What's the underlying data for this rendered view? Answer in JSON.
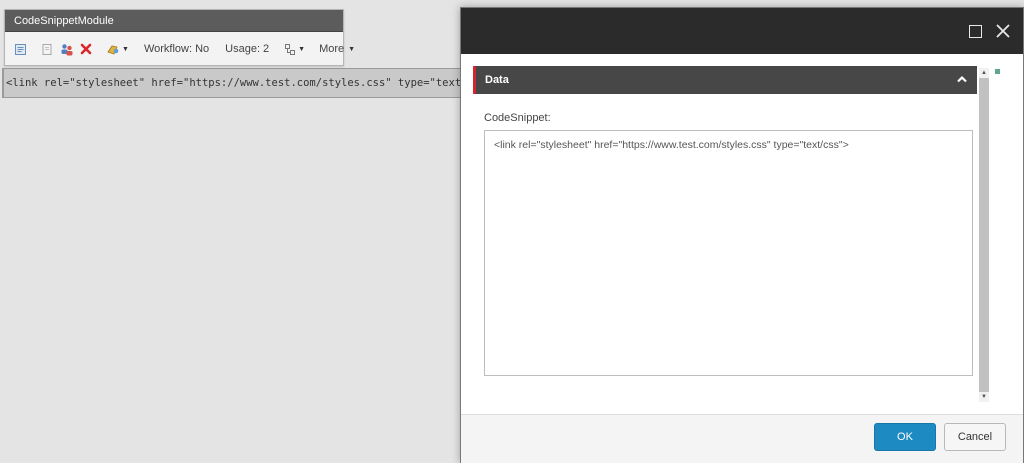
{
  "rendering": {
    "code": "<link rel=\"stylesheet\" href=\"https://www.test.com/styles.css\" type=\"text/css\">"
  },
  "chrome": {
    "title": "CodeSnippetModule",
    "workflow_label": "Workflow: No",
    "usage_label": "Usage: 2",
    "more_label": "More",
    "icons": [
      "edit-icon",
      "copy-icon",
      "personalize-icon",
      "delete-icon",
      "test-icon",
      "change-rendering-icon"
    ]
  },
  "dialog": {
    "section_title": "Data",
    "field_label": "CodeSnippet:",
    "field_value": "<link rel=\"stylesheet\" href=\"https://www.test.com/styles.css\" type=\"text/css\">",
    "ok_label": "OK",
    "cancel_label": "Cancel"
  },
  "colors": {
    "accent_red": "#d0272f",
    "ok_blue": "#1d8bc2",
    "dialog_header": "#2b2b2b",
    "section_header": "#474747",
    "status_green": "#5fa78b"
  }
}
